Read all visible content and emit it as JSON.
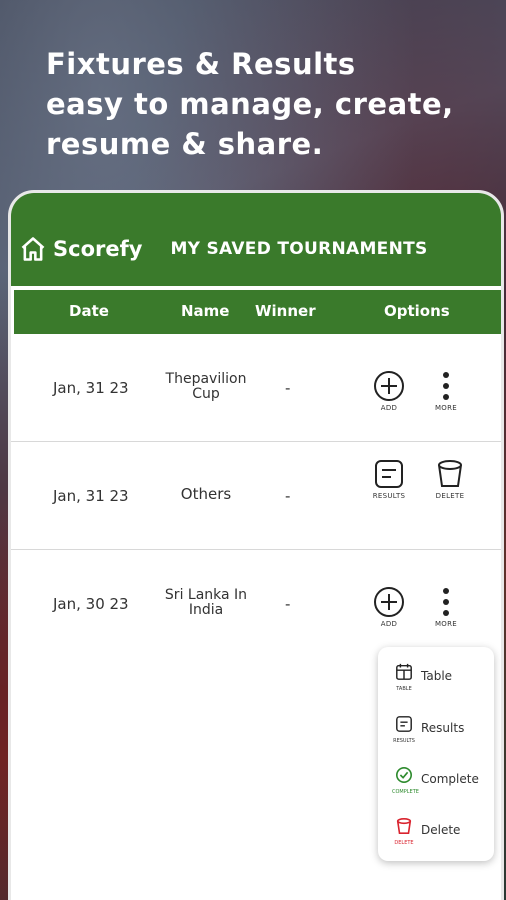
{
  "headline": {
    "line1": "Fixtures & Results",
    "line2": "easy to manage, create,",
    "line3": "resume & share."
  },
  "appbar": {
    "app_name": "Scorefy",
    "title": "MY SAVED TOURNAMENTS",
    "home_icon": "home-icon"
  },
  "table": {
    "headers": {
      "date": "Date",
      "name": "Name",
      "winner": "Winner",
      "options": "Options"
    },
    "rows": [
      {
        "date": "Jan, 31 23",
        "name": "Thepavilion Cup",
        "winner": "-",
        "opt1": "ADD",
        "opt2": "MORE"
      },
      {
        "date": "Jan, 31 23",
        "name": "Others",
        "winner": "-",
        "opt1": "RESULTS",
        "opt2": "DELETE"
      },
      {
        "date": "Jan, 30 23",
        "name": "Sri Lanka In India",
        "winner": "-",
        "opt1": "ADD",
        "opt2": "MORE"
      }
    ]
  },
  "menu": {
    "items": [
      {
        "label": "Table",
        "sub": "TABLE",
        "icon": "table-icon"
      },
      {
        "label": "Results",
        "sub": "RESULTS",
        "icon": "results-icon"
      },
      {
        "label": "Complete",
        "sub": "COMPLETE",
        "icon": "check-circle-icon"
      },
      {
        "label": "Delete",
        "sub": "DELETE",
        "icon": "trash-icon"
      }
    ]
  },
  "colors": {
    "primary_green": "#3a7a2b",
    "complete_green": "#2e8b2e",
    "delete_red": "#d9232e"
  }
}
